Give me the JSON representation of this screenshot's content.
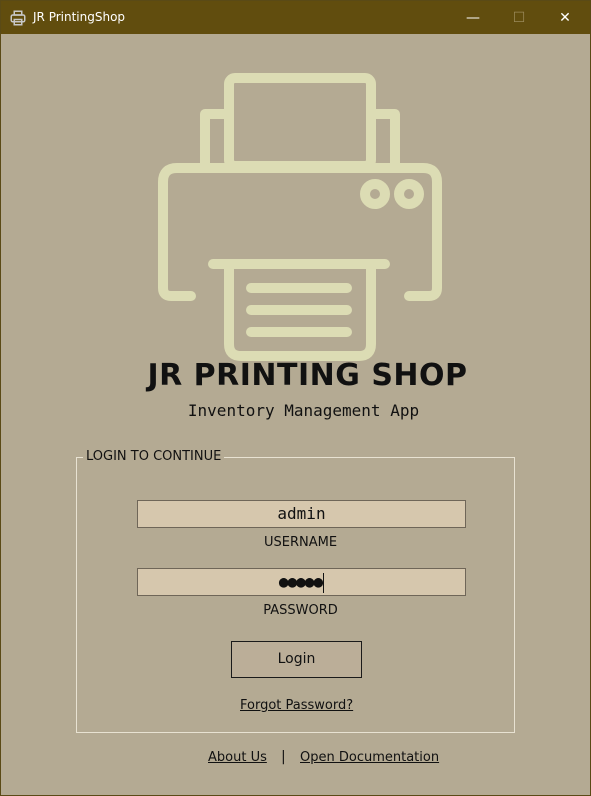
{
  "window": {
    "title": "JR PrintingShop",
    "minimize_glyph": "—",
    "maximize_glyph": "☐",
    "close_glyph": "✕"
  },
  "header": {
    "title": "JR PRINTING SHOP",
    "subtitle": "Inventory Management App",
    "logo_icon": "printer-icon"
  },
  "login": {
    "group_label": "LOGIN TO CONTINUE",
    "username_value": "admin",
    "username_label": "USERNAME",
    "password_value": "●●●●●",
    "password_label": "PASSWORD",
    "login_button": "Login",
    "forgot_password": "Forgot Password?"
  },
  "footer": {
    "about": "About Us",
    "separator": "|",
    "documentation": "Open Documentation"
  },
  "colors": {
    "titlebar": "#614d0e",
    "background": "#b4aa93",
    "input_bg": "#d6c7ad",
    "logo": "#dcdcb4"
  }
}
